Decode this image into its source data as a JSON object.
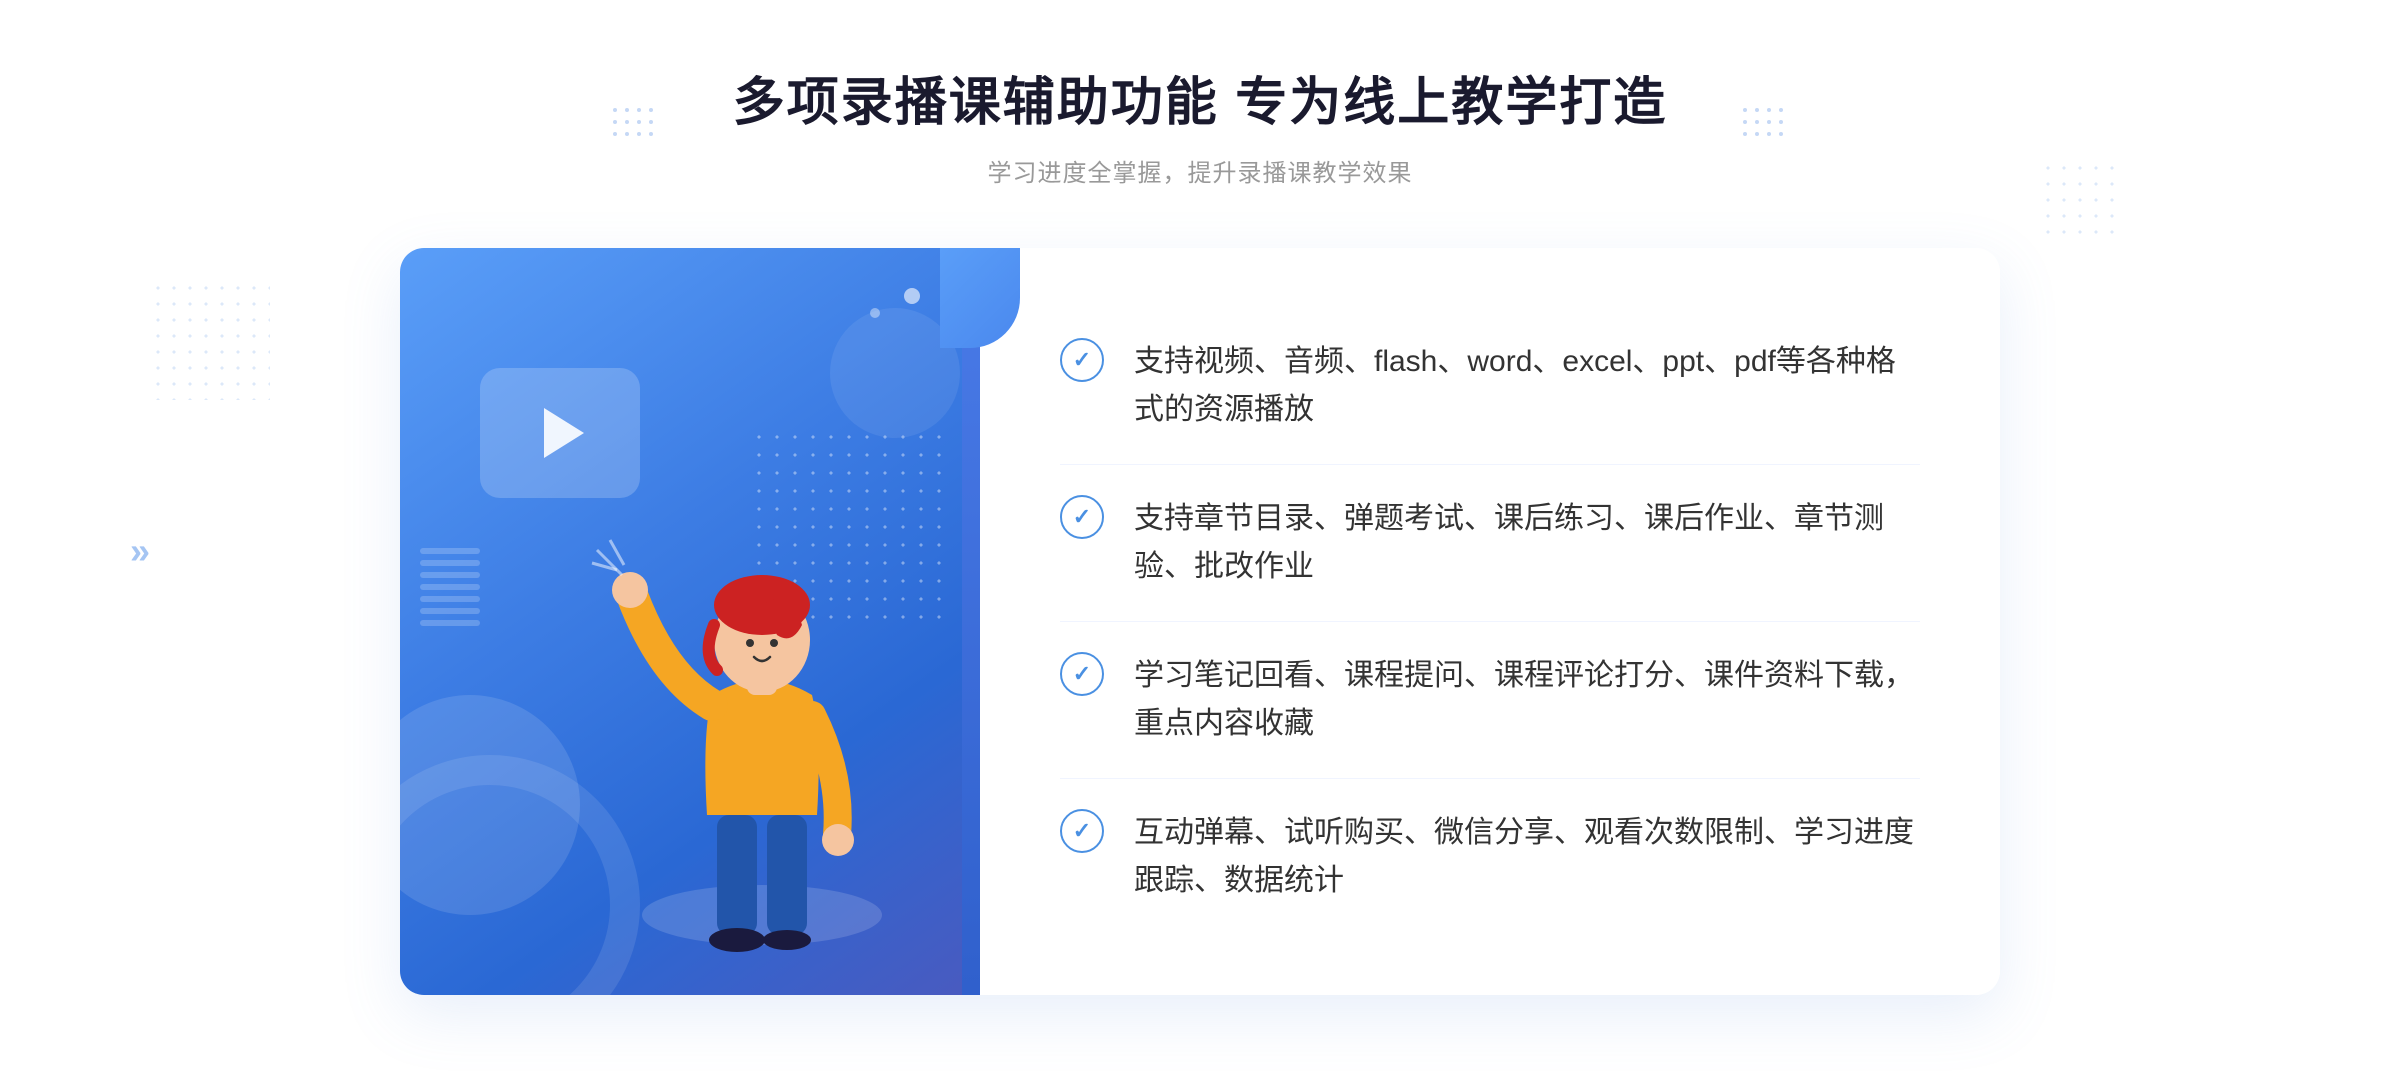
{
  "header": {
    "title": "多项录播课辅助功能 专为线上教学打造",
    "subtitle": "学习进度全掌握，提升录播课教学效果"
  },
  "features": [
    {
      "id": "feature-1",
      "text": "支持视频、音频、flash、word、excel、ppt、pdf等各种格式的资源播放"
    },
    {
      "id": "feature-2",
      "text": "支持章节目录、弹题考试、课后练习、课后作业、章节测验、批改作业"
    },
    {
      "id": "feature-3",
      "text": "学习笔记回看、课程提问、课程评论打分、课件资料下载，重点内容收藏"
    },
    {
      "id": "feature-4",
      "text": "互动弹幕、试听购买、微信分享、观看次数限制、学习进度跟踪、数据统计"
    }
  ],
  "decorations": {
    "chevron_left": "»",
    "chevron_right": "···"
  }
}
